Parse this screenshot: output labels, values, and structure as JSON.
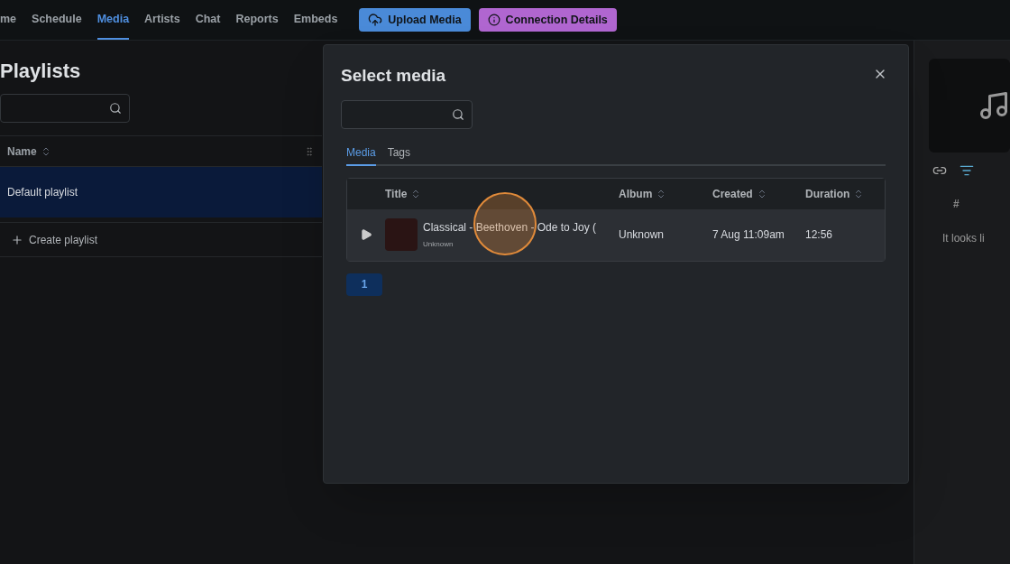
{
  "nav": {
    "items": [
      {
        "label": "me",
        "selected": false
      },
      {
        "label": "Schedule",
        "selected": false
      },
      {
        "label": "Media",
        "selected": true
      },
      {
        "label": "Artists",
        "selected": false
      },
      {
        "label": "Chat",
        "selected": false
      },
      {
        "label": "Reports",
        "selected": false
      },
      {
        "label": "Embeds",
        "selected": false
      }
    ],
    "buttons": [
      {
        "kind": "upload",
        "label": "Upload Media"
      },
      {
        "kind": "info",
        "label": "Connection Details"
      }
    ]
  },
  "playlists": {
    "title": "Playlists",
    "column": "Name",
    "rows": [
      {
        "name": "Default playlist",
        "selected": true
      }
    ],
    "create_label": "Create playlist"
  },
  "side_panel": {
    "column": "#",
    "empty_text": "It looks li"
  },
  "modal": {
    "title": "Select media",
    "tabs": [
      {
        "label": "Media",
        "selected": true
      },
      {
        "label": "Tags",
        "selected": false
      }
    ],
    "columns": [
      "Title",
      "Album",
      "Created",
      "Duration"
    ],
    "rows": [
      {
        "title": "Classical - Beethoven - Ode to Joy (",
        "artist": "Unknown",
        "album": "Unknown",
        "created": "7 Aug 11:09am",
        "duration": "12:56"
      }
    ],
    "pages": [
      {
        "label": "1",
        "selected": true
      }
    ]
  }
}
